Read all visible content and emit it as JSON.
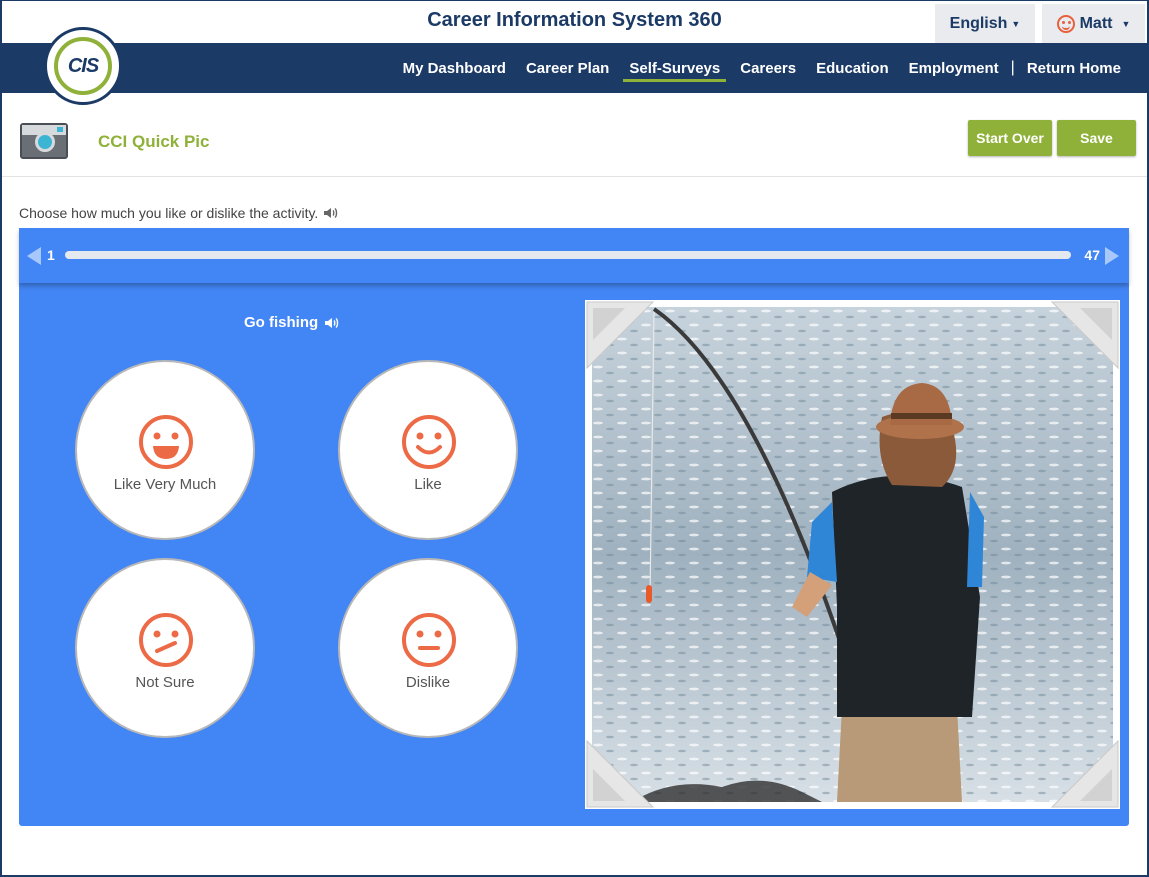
{
  "header": {
    "app_title": "Career Information System 360",
    "language": "English",
    "user": "Matt",
    "logo_text": "CIS"
  },
  "nav": {
    "items": [
      {
        "label": "My Dashboard",
        "active": false
      },
      {
        "label": "Career Plan",
        "active": false
      },
      {
        "label": "Self-Surveys",
        "active": true
      },
      {
        "label": "Careers",
        "active": false
      },
      {
        "label": "Education",
        "active": false
      },
      {
        "label": "Employment",
        "active": false
      },
      {
        "label": "Return Home",
        "active": false
      }
    ],
    "separator": "|"
  },
  "page": {
    "title": "CCI Quick Pic",
    "start_over_label": "Start Over",
    "save_label": "Save",
    "instruction": "Choose how much you like or dislike the activity."
  },
  "progress": {
    "current": "1",
    "total": "47",
    "fraction": 0.0
  },
  "question": {
    "activity": "Go fishing",
    "choices": [
      {
        "label": "Like Very Much",
        "icon": "grin-face-icon"
      },
      {
        "label": "Like",
        "icon": "smile-face-icon"
      },
      {
        "label": "Not Sure",
        "icon": "unsure-face-icon"
      },
      {
        "label": "Dislike",
        "icon": "neutral-face-icon"
      }
    ]
  },
  "colors": {
    "navy": "#1b3a66",
    "green": "#8fb13a",
    "panel_blue": "#4285f4",
    "face_orange": "#ec6a45"
  }
}
